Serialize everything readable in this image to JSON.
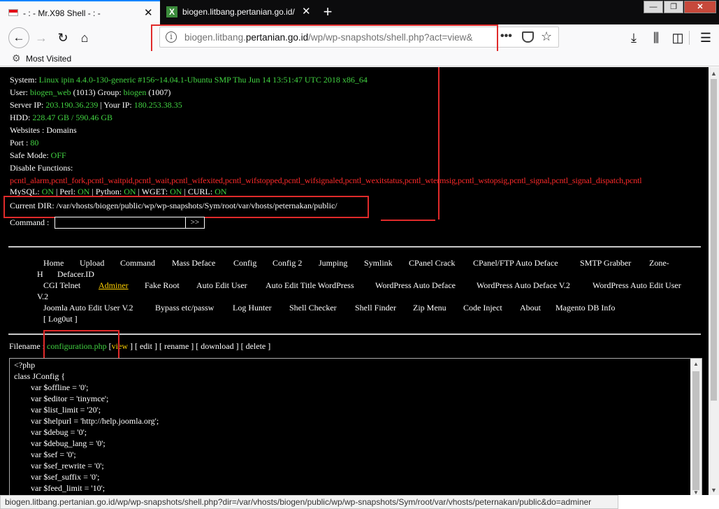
{
  "tabs": [
    {
      "title": "- : - Mr.X98 Shell - : -",
      "close": "✕"
    },
    {
      "title": "biogen.litbang.pertanian.go.id/",
      "close": "✕"
    }
  ],
  "window_controls": {
    "new_tab": "+",
    "minimize": "—",
    "maximize": "❐",
    "close": "✕"
  },
  "url": {
    "prefix": "biogen.litbang.",
    "domain": "pertanian.go.id",
    "path": "/wp/wp-snapshots/shell.php?act=view&"
  },
  "toolbar": {
    "more": "•••"
  },
  "bookmarks": {
    "most_visited": "Most Visited"
  },
  "info": {
    "system_label": "System:",
    "system_value": "Linux ipin 4.4.0-130-generic #156~14.04.1-Ubuntu SMP Thu Jun 14 13:51:47 UTC 2018 x86_64",
    "user_label": "User:",
    "user": "biogen_web",
    "uid": "(1013)",
    "group_label": "Group:",
    "group": "biogen",
    "gid": "(1007)",
    "server_ip_label": "Server IP:",
    "server_ip": "203.190.36.239",
    "your_ip_label": "| Your IP:",
    "your_ip": "180.253.38.35",
    "hdd_label": "HDD:",
    "hdd_free": "228.47 GB",
    "hdd_sep": "/",
    "hdd_total": "590.46 GB",
    "websites": "Websites : Domains",
    "port_label": "Port :",
    "port": "80",
    "safe_mode_label": "Safe Mode:",
    "safe_mode": "OFF",
    "disable_label": "Disable Functions:",
    "disabled_functions": "pcntl_alarm,pcntl_fork,pcntl_waitpid,pcntl_wait,pcntl_wifexited,pcntl_wifstopped,pcntl_wifsignaled,pcntl_wexitstatus,pcntl_wtermsig,pcntl_wstopsig,pcntl_signal,pcntl_signal_dispatch,pcntl",
    "mysql_label": "MySQL:",
    "mysql": "ON",
    "perl_label": "| Perl:",
    "perl": "ON",
    "python_label": "| Python:",
    "python": "ON",
    "wget_label": "| WGET:",
    "wget": "ON",
    "curl_label": "| CURL:",
    "curl": "ON",
    "current_dir_label": "Current DIR:",
    "current_dir": "/var/vhosts/biogen/public/wp/wp-snapshots/Sym/root/var/vhosts/peternakan/public/",
    "command_label": "Command :",
    "command_button": ">>"
  },
  "menu": {
    "row1": [
      "Home",
      "Upload",
      "Command",
      "Mass Deface",
      "Config",
      "Config 2",
      "Jumping",
      "Symlink",
      "CPanel Crack",
      "CPanel/FTP Auto Deface",
      "SMTP Grabber",
      "Zone-"
    ],
    "row1b": [
      "H",
      "Defacer.ID"
    ],
    "row2": [
      "CGI Telnet",
      "Adminer",
      "Fake Root",
      "Auto Edit User",
      "Auto Edit Title WordPress",
      "WordPress Auto Deface",
      "WordPress Auto Deface V.2",
      "WordPress Auto Edit User"
    ],
    "row2b": "V.2",
    "row3": [
      "Joomla Auto Edit User V.2",
      "Bypass etc/passw",
      "Log Hunter",
      "Shell Checker",
      "Shell Finder",
      "Zip Menu",
      "Code Inject",
      "About",
      "Magento DB Info"
    ],
    "row4": "[ Log0ut ]"
  },
  "file": {
    "label": "Filename :",
    "name": "configuration.php",
    "view_open": "[",
    "view": "view",
    "actions": "] [ edit ] [ rename ] [ download ] [ delete ]"
  },
  "code_lines": [
    "<?php",
    "class JConfig {",
    "        var $offline = '0';",
    "        var $editor = 'tinymce';",
    "        var $list_limit = '20';",
    "        var $helpurl = 'http://help.joomla.org';",
    "        var $debug = '0';",
    "        var $debug_lang = '0';",
    "        var $sef = '0';",
    "        var $sef_rewrite = '0';",
    "        var $sef_suffix = '0';",
    "        var $feed_limit = '10';"
  ],
  "status_url": "biogen.litbang.pertanian.go.id/wp/wp-snapshots/shell.php?dir=/var/vhosts/biogen/public/wp/wp-snapshots/Sym/root/var/vhosts/peternakan/public&do=adminer",
  "colors": {
    "green": "#42d442",
    "red": "#ff2a2a",
    "yellow": "#ffd000",
    "highlight": "#e02a2a"
  }
}
